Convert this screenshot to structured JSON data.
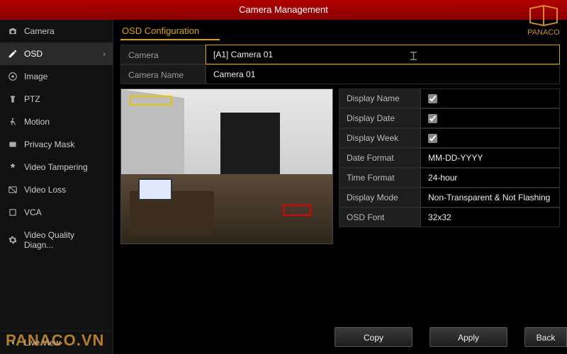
{
  "titlebar": {
    "title": "Camera Management"
  },
  "sidebar": {
    "items": [
      {
        "label": "Camera"
      },
      {
        "label": "OSD"
      },
      {
        "label": "Image"
      },
      {
        "label": "PTZ"
      },
      {
        "label": "Motion"
      },
      {
        "label": "Privacy Mask"
      },
      {
        "label": "Video Tampering"
      },
      {
        "label": "Video Loss"
      },
      {
        "label": "VCA"
      },
      {
        "label": "Video Quality Diagn..."
      }
    ],
    "liveview": "Live View"
  },
  "section": {
    "title": "OSD Configuration"
  },
  "form": {
    "camera_label": "Camera",
    "camera_value": "[A1] Camera 01",
    "camera_name_label": "Camera Name",
    "camera_name_value": "Camera 01"
  },
  "settings": {
    "display_name": {
      "label": "Display Name",
      "checked": true
    },
    "display_date": {
      "label": "Display Date",
      "checked": true
    },
    "display_week": {
      "label": "Display Week",
      "checked": true
    },
    "date_format": {
      "label": "Date Format",
      "value": "MM-DD-YYYY"
    },
    "time_format": {
      "label": "Time Format",
      "value": "24-hour"
    },
    "display_mode": {
      "label": "Display Mode",
      "value": "Non-Transparent & Not Flashing"
    },
    "osd_font": {
      "label": "OSD Font",
      "value": "32x32"
    }
  },
  "buttons": {
    "copy": "Copy",
    "apply": "Apply",
    "back": "Back"
  },
  "branding": {
    "logo_text": "PANACO",
    "watermark": "PANACO.VN"
  }
}
